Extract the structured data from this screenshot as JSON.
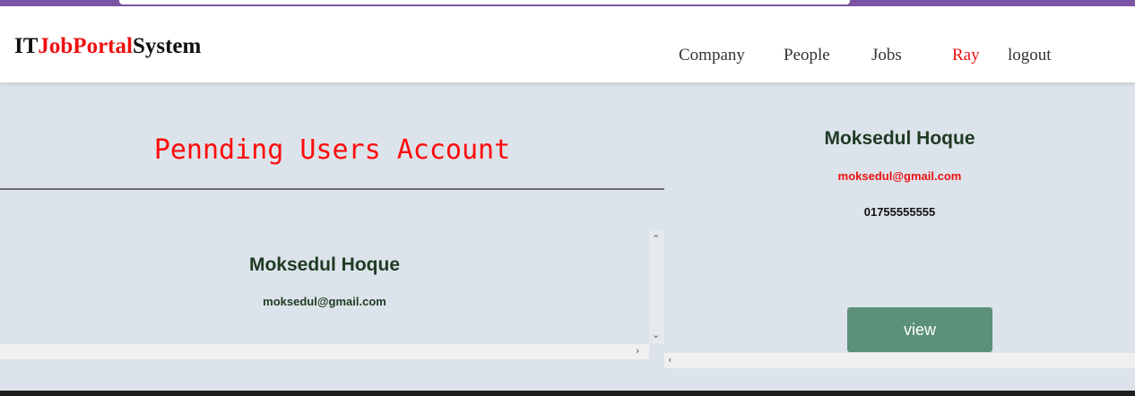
{
  "brand": {
    "part1": "IT",
    "part2": "JobPortal",
    "part3": "System"
  },
  "nav": {
    "company": "Company",
    "people": "People",
    "jobs": "Jobs",
    "user": "Ray",
    "logout": "logout"
  },
  "left_panel": {
    "title": "Pennding Users Account",
    "user": {
      "name": "Moksedul Hoque",
      "email": "moksedul@gmail.com"
    }
  },
  "right_panel": {
    "name": "Moksedul Hoque",
    "email": "moksedul@gmail.com",
    "phone": "01755555555",
    "view_label": "view"
  },
  "colors": {
    "accent_red": "#ee1111",
    "button_green": "#5b9179",
    "background": "#dce3ea",
    "top_strip": "#7b54a5"
  },
  "icons": {
    "scroll_up": "chevron-up-icon",
    "scroll_down": "chevron-down-icon",
    "scroll_right": "chevron-right-icon",
    "scroll_left": "chevron-left-icon"
  }
}
